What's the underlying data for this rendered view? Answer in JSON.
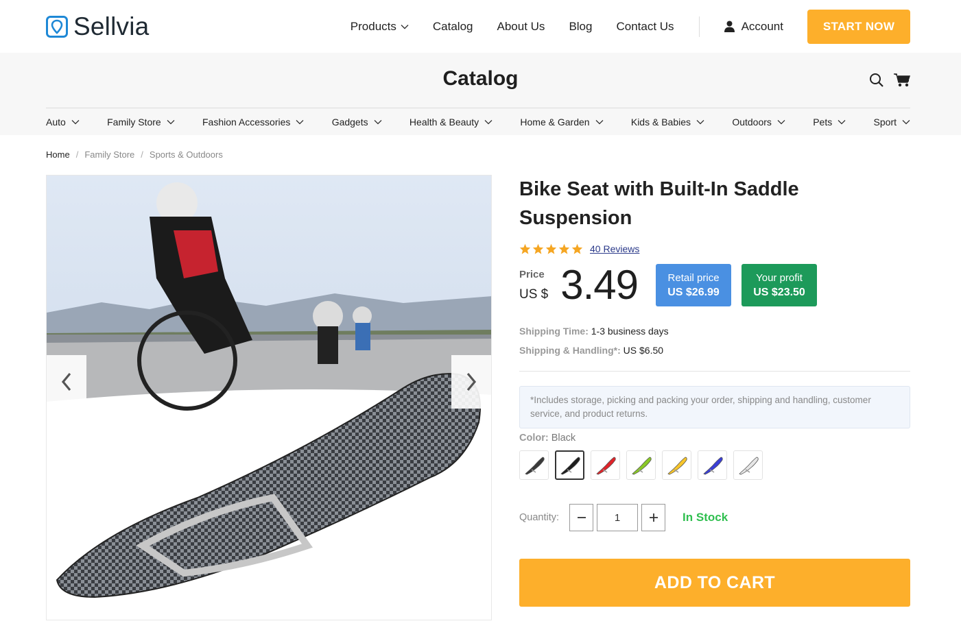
{
  "brand": {
    "name": "Sellvia"
  },
  "nav": {
    "items": [
      {
        "label": "Products",
        "dropdown": true
      },
      {
        "label": "Catalog",
        "dropdown": false
      },
      {
        "label": "About Us",
        "dropdown": false
      },
      {
        "label": "Blog",
        "dropdown": false
      },
      {
        "label": "Contact Us",
        "dropdown": false
      }
    ],
    "account_label": "Account",
    "start_label": "START NOW"
  },
  "catalog": {
    "title": "Catalog",
    "categories": [
      "Auto",
      "Family Store",
      "Fashion Accessories",
      "Gadgets",
      "Health & Beauty",
      "Home & Garden",
      "Kids & Babies",
      "Outdoors",
      "Pets",
      "Sport"
    ]
  },
  "breadcrumb": [
    "Home",
    "Family Store",
    "Sports & Outdoors"
  ],
  "product": {
    "title": "Bike Seat with Built-In Saddle Suspension",
    "rating": 5,
    "reviews_label": "40 Reviews",
    "price_label": "Price",
    "currency": "US $",
    "price": "3.49",
    "retail_label": "Retail price",
    "retail_value": "US $26.99",
    "profit_label": "Your profit",
    "profit_value": "US $23.50",
    "shipping_time_label": "Shipping Time:",
    "shipping_time_value": "1-3 business days",
    "shipping_handling_label": "Shipping & Handling*:",
    "shipping_handling_value": "US $6.50",
    "note": "*Includes storage, picking and packing your order, shipping and handling, customer service, and product returns.",
    "color_label": "Color:",
    "color_value": "Black",
    "swatches": [
      {
        "color": "#3a3a3a",
        "active": false
      },
      {
        "color": "#1e1e1e",
        "active": true
      },
      {
        "color": "#e0242a",
        "active": false
      },
      {
        "color": "#8ac926",
        "active": false
      },
      {
        "color": "#f7c52a",
        "active": false
      },
      {
        "color": "#3b3fd6",
        "active": false
      },
      {
        "color": "#e6e6e6",
        "active": false
      }
    ],
    "quantity_label": "Quantity:",
    "quantity": "1",
    "stock_label": "In Stock",
    "cart_label": "ADD TO CART"
  },
  "colors": {
    "accent": "#fdaf2b",
    "retail": "#4a90e2",
    "profit": "#1d9a5a",
    "stock": "#2fbf4f"
  }
}
